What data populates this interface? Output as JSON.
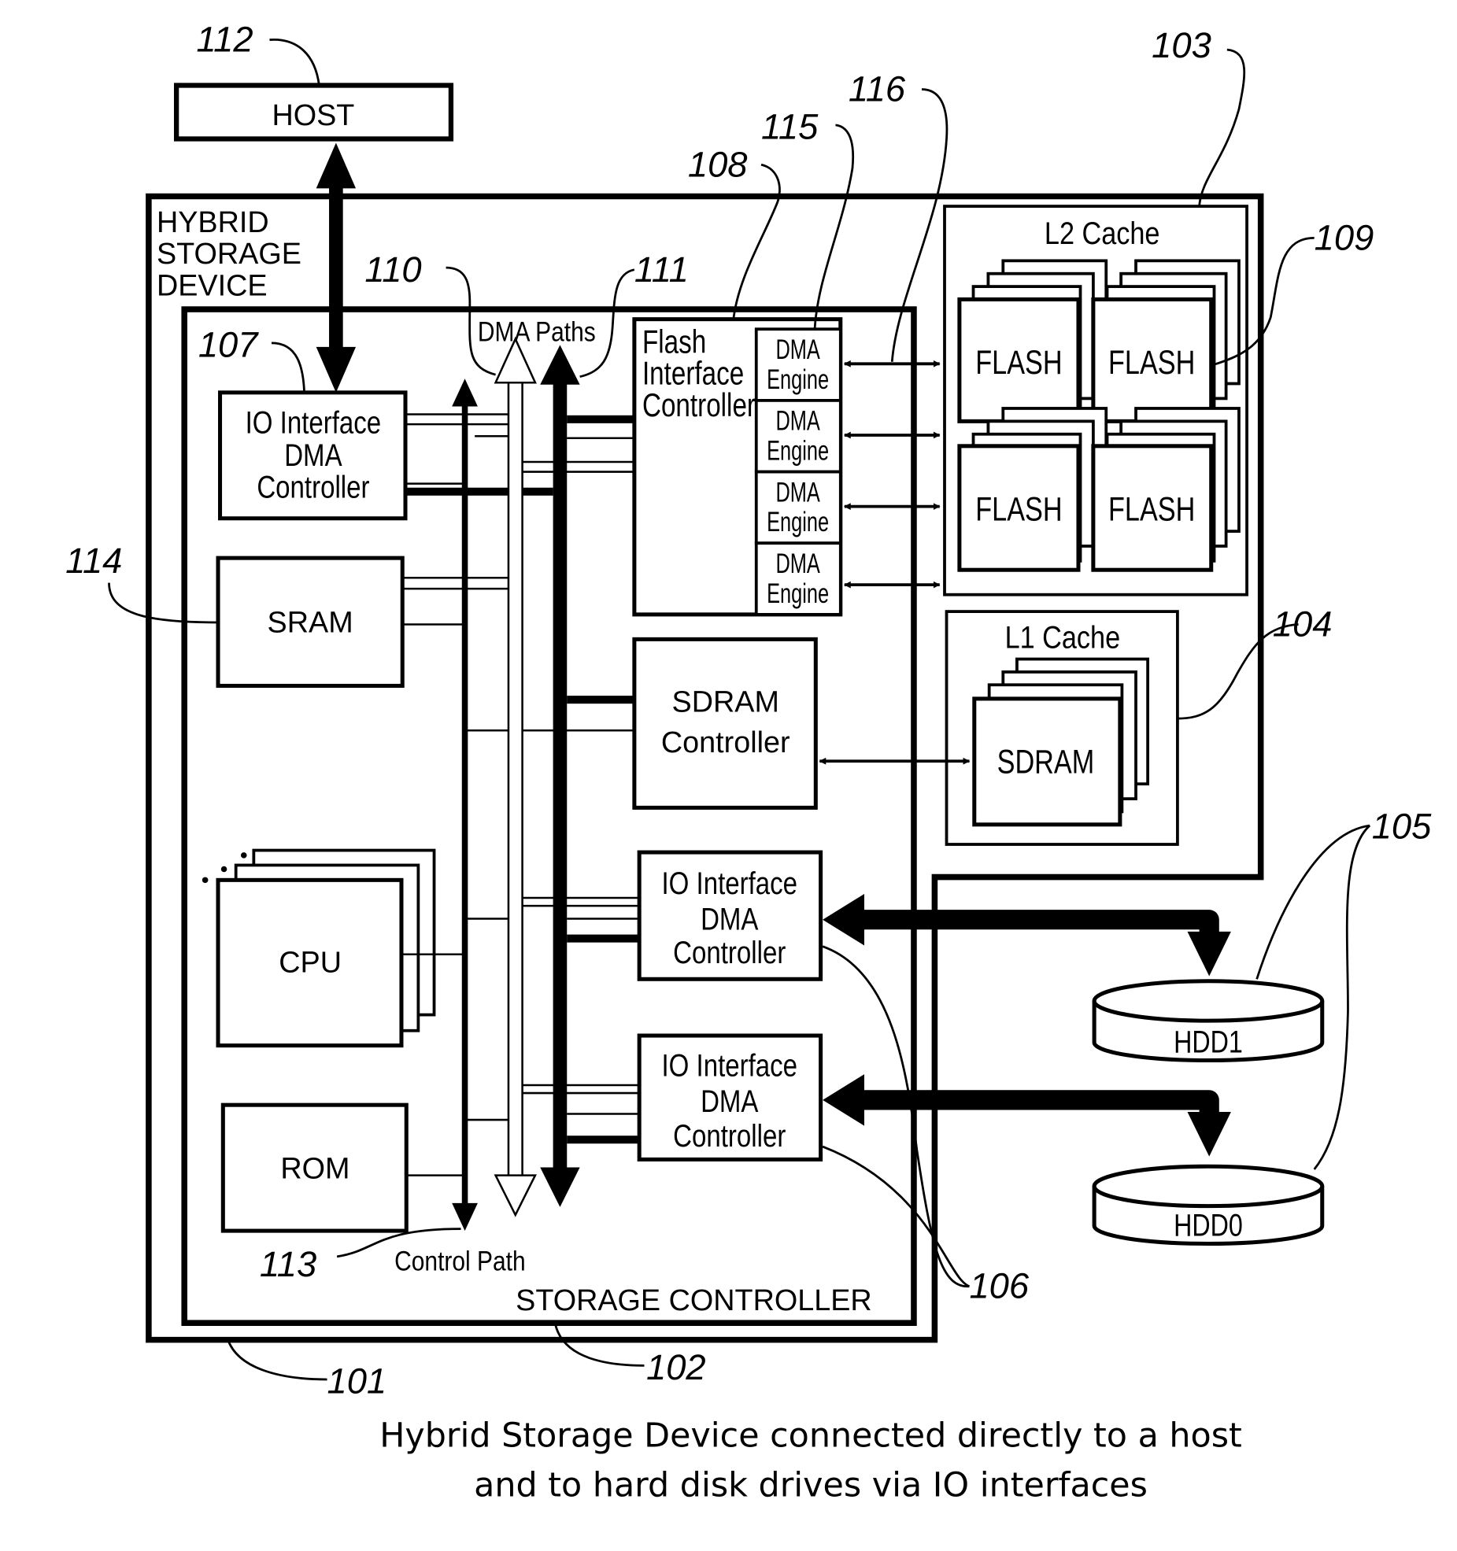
{
  "figure": {
    "caption_line1": "Hybrid Storage Device connected directly to a host",
    "caption_line2": "and to hard disk drives via IO interfaces"
  },
  "blocks": {
    "host": "HOST",
    "hybrid_device": [
      "HYBRID",
      "STORAGE",
      "DEVICE"
    ],
    "storage_controller": "STORAGE CONTROLLER",
    "io_dma_top": [
      "IO Interface",
      "DMA",
      "Controller"
    ],
    "sram": "SRAM",
    "cpu": "CPU",
    "rom": "ROM",
    "flash_controller": [
      "Flash",
      "Interface",
      "Controller"
    ],
    "dma_engine": [
      "DMA",
      "Engine"
    ],
    "sdram_controller": [
      "SDRAM",
      "Controller"
    ],
    "io_dma_mid": [
      "IO Interface",
      "DMA",
      "Controller"
    ],
    "io_dma_bottom": [
      "IO Interface",
      "DMA",
      "Controller"
    ],
    "l2_cache": "L2 Cache",
    "flash": "FLASH",
    "l1_cache": "L1 Cache",
    "sdram": "SDRAM",
    "hdd1": "HDD1",
    "hdd0": "HDD0",
    "dma_paths": "DMA Paths",
    "control_path": "Control Path"
  },
  "refs": {
    "r101": "101",
    "r102": "102",
    "r103": "103",
    "r104": "104",
    "r105": "105",
    "r106": "106",
    "r107": "107",
    "r108": "108",
    "r109": "109",
    "r110": "110",
    "r111": "111",
    "r112": "112",
    "r113": "113",
    "r114": "114",
    "r115": "115",
    "r116": "116"
  }
}
